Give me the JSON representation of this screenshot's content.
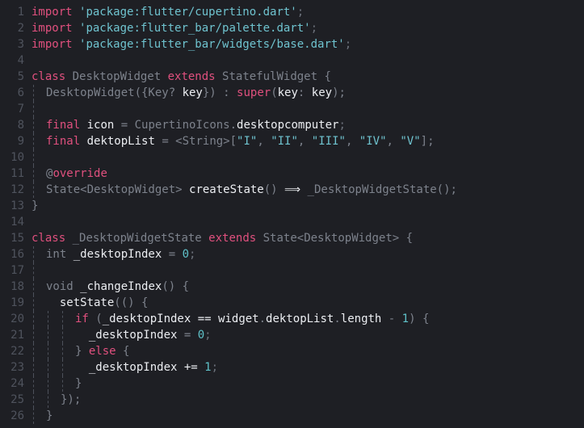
{
  "editor": {
    "lines": [
      {
        "num": "1",
        "indent": 0,
        "tokens": [
          {
            "t": "import",
            "c": "kw"
          },
          {
            "t": " ",
            "c": "plain"
          },
          {
            "t": "'package:flutter/cupertino.dart'",
            "c": "str"
          },
          {
            "t": ";",
            "c": "punct"
          }
        ]
      },
      {
        "num": "2",
        "indent": 0,
        "tokens": [
          {
            "t": "import",
            "c": "kw"
          },
          {
            "t": " ",
            "c": "plain"
          },
          {
            "t": "'package:flutter_bar/palette.dart'",
            "c": "str"
          },
          {
            "t": ";",
            "c": "punct"
          }
        ]
      },
      {
        "num": "3",
        "indent": 0,
        "tokens": [
          {
            "t": "import",
            "c": "kw"
          },
          {
            "t": " ",
            "c": "plain"
          },
          {
            "t": "'package:flutter_bar/widgets/base.dart'",
            "c": "str"
          },
          {
            "t": ";",
            "c": "punct"
          }
        ]
      },
      {
        "num": "4",
        "indent": 0,
        "tokens": []
      },
      {
        "num": "5",
        "indent": 0,
        "tokens": [
          {
            "t": "class",
            "c": "kw"
          },
          {
            "t": " DesktopWidget ",
            "c": "dim"
          },
          {
            "t": "extends",
            "c": "kw"
          },
          {
            "t": " StatefulWidget {",
            "c": "dim"
          }
        ]
      },
      {
        "num": "6",
        "indent": 1,
        "tokens": [
          {
            "t": "DesktopWidget({Key? ",
            "c": "dim"
          },
          {
            "t": "key",
            "c": "plain"
          },
          {
            "t": "}) : ",
            "c": "dim"
          },
          {
            "t": "super",
            "c": "kw"
          },
          {
            "t": "(",
            "c": "dim"
          },
          {
            "t": "key",
            "c": "plain"
          },
          {
            "t": ": ",
            "c": "dim"
          },
          {
            "t": "key",
            "c": "plain"
          },
          {
            "t": ");",
            "c": "dim"
          }
        ]
      },
      {
        "num": "7",
        "indent": 1,
        "tokens": []
      },
      {
        "num": "8",
        "indent": 1,
        "tokens": [
          {
            "t": "final",
            "c": "kw"
          },
          {
            "t": " ",
            "c": "plain"
          },
          {
            "t": "icon",
            "c": "plain"
          },
          {
            "t": " = CupertinoIcons.",
            "c": "dim"
          },
          {
            "t": "desktopcomputer",
            "c": "plain"
          },
          {
            "t": ";",
            "c": "punct"
          }
        ]
      },
      {
        "num": "9",
        "indent": 1,
        "tokens": [
          {
            "t": "final",
            "c": "kw"
          },
          {
            "t": " ",
            "c": "plain"
          },
          {
            "t": "dektopList",
            "c": "plain"
          },
          {
            "t": " = <String>[",
            "c": "dim"
          },
          {
            "t": "\"I\"",
            "c": "str"
          },
          {
            "t": ", ",
            "c": "dim"
          },
          {
            "t": "\"II\"",
            "c": "str"
          },
          {
            "t": ", ",
            "c": "dim"
          },
          {
            "t": "\"III\"",
            "c": "str"
          },
          {
            "t": ", ",
            "c": "dim"
          },
          {
            "t": "\"IV\"",
            "c": "str"
          },
          {
            "t": ", ",
            "c": "dim"
          },
          {
            "t": "\"V\"",
            "c": "str"
          },
          {
            "t": "];",
            "c": "dim"
          }
        ]
      },
      {
        "num": "10",
        "indent": 1,
        "tokens": []
      },
      {
        "num": "11",
        "indent": 1,
        "tokens": [
          {
            "t": "@",
            "c": "dim"
          },
          {
            "t": "override",
            "c": "kw"
          }
        ]
      },
      {
        "num": "12",
        "indent": 1,
        "tokens": [
          {
            "t": "State<DesktopWidget> ",
            "c": "dim"
          },
          {
            "t": "createState",
            "c": "plain"
          },
          {
            "t": "() ",
            "c": "dim"
          },
          {
            "t": "⟹",
            "c": "plain"
          },
          {
            "t": " _DesktopWidgetState();",
            "c": "dim"
          }
        ]
      },
      {
        "num": "13",
        "indent": 0,
        "tokens": [
          {
            "t": "}",
            "c": "dim"
          }
        ]
      },
      {
        "num": "14",
        "indent": 0,
        "tokens": []
      },
      {
        "num": "15",
        "indent": 0,
        "tokens": [
          {
            "t": "class",
            "c": "kw"
          },
          {
            "t": " _DesktopWidgetState ",
            "c": "dim"
          },
          {
            "t": "extends",
            "c": "kw"
          },
          {
            "t": " State<DesktopWidget> {",
            "c": "dim"
          }
        ]
      },
      {
        "num": "16",
        "indent": 1,
        "tokens": [
          {
            "t": "int ",
            "c": "dim"
          },
          {
            "t": "_desktopIndex",
            "c": "plain"
          },
          {
            "t": " = ",
            "c": "dim"
          },
          {
            "t": "0",
            "c": "num"
          },
          {
            "t": ";",
            "c": "punct"
          }
        ]
      },
      {
        "num": "17",
        "indent": 1,
        "tokens": []
      },
      {
        "num": "18",
        "indent": 1,
        "tokens": [
          {
            "t": "void ",
            "c": "dim"
          },
          {
            "t": "_changeIndex",
            "c": "plain"
          },
          {
            "t": "() {",
            "c": "dim"
          }
        ]
      },
      {
        "num": "19",
        "indent": 1,
        "tokens": [
          {
            "t": "  ",
            "c": "plain"
          },
          {
            "t": "setState",
            "c": "plain"
          },
          {
            "t": "(() {",
            "c": "dim"
          }
        ]
      },
      {
        "num": "20",
        "indent": 3,
        "tokens": [
          {
            "t": "if",
            "c": "kw"
          },
          {
            "t": " (",
            "c": "dim"
          },
          {
            "t": "_desktopIndex",
            "c": "plain"
          },
          {
            "t": " ",
            "c": "plain"
          },
          {
            "t": "==",
            "c": "plain"
          },
          {
            "t": " ",
            "c": "plain"
          },
          {
            "t": "widget",
            "c": "plain"
          },
          {
            "t": ".",
            "c": "dim"
          },
          {
            "t": "dektopList",
            "c": "plain"
          },
          {
            "t": ".",
            "c": "dim"
          },
          {
            "t": "length",
            "c": "plain"
          },
          {
            "t": " - ",
            "c": "dim"
          },
          {
            "t": "1",
            "c": "num"
          },
          {
            "t": ") {",
            "c": "dim"
          }
        ]
      },
      {
        "num": "21",
        "indent": 3,
        "tokens": [
          {
            "t": "  ",
            "c": "plain"
          },
          {
            "t": "_desktopIndex",
            "c": "plain"
          },
          {
            "t": " = ",
            "c": "dim"
          },
          {
            "t": "0",
            "c": "num"
          },
          {
            "t": ";",
            "c": "punct"
          }
        ]
      },
      {
        "num": "22",
        "indent": 3,
        "tokens": [
          {
            "t": "} ",
            "c": "dim"
          },
          {
            "t": "else",
            "c": "kw"
          },
          {
            "t": " {",
            "c": "dim"
          }
        ]
      },
      {
        "num": "23",
        "indent": 3,
        "tokens": [
          {
            "t": "  ",
            "c": "plain"
          },
          {
            "t": "_desktopIndex",
            "c": "plain"
          },
          {
            "t": " ",
            "c": "plain"
          },
          {
            "t": "+=",
            "c": "plain"
          },
          {
            "t": " ",
            "c": "plain"
          },
          {
            "t": "1",
            "c": "num"
          },
          {
            "t": ";",
            "c": "punct"
          }
        ]
      },
      {
        "num": "24",
        "indent": 3,
        "tokens": [
          {
            "t": "}",
            "c": "dim"
          }
        ]
      },
      {
        "num": "25",
        "indent": 2,
        "tokens": [
          {
            "t": "});",
            "c": "dim"
          }
        ]
      },
      {
        "num": "26",
        "indent": 1,
        "tokens": [
          {
            "t": "}",
            "c": "dim"
          }
        ]
      }
    ]
  }
}
